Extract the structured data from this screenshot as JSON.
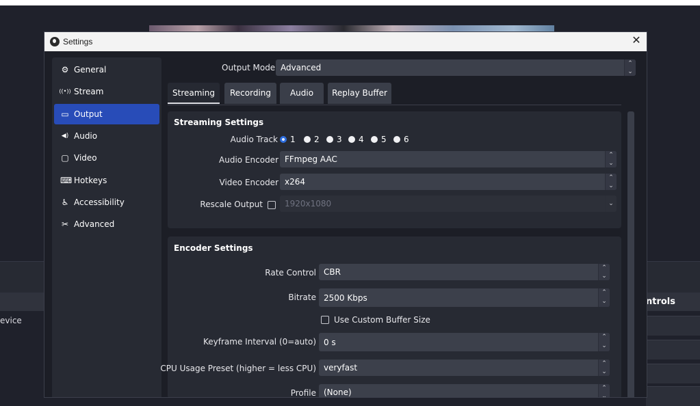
{
  "background": {
    "left_panel_item": "evice",
    "right_panel_header": "ntrols"
  },
  "dialog": {
    "title": "Settings",
    "close_glyph": "✕"
  },
  "sidebar": {
    "items": [
      {
        "label": "General",
        "icon": "gear-icon",
        "glyph": "⚙",
        "active": false
      },
      {
        "label": "Stream",
        "icon": "antenna-icon",
        "glyph": "((•))",
        "active": false
      },
      {
        "label": "Output",
        "icon": "monitor-output-icon",
        "glyph": "▭",
        "active": true
      },
      {
        "label": "Audio",
        "icon": "speaker-icon",
        "glyph": "◀)",
        "active": false
      },
      {
        "label": "Video",
        "icon": "screen-icon",
        "glyph": "▢",
        "active": false
      },
      {
        "label": "Hotkeys",
        "icon": "keyboard-icon",
        "glyph": "⌨",
        "active": false
      },
      {
        "label": "Accessibility",
        "icon": "accessibility-icon",
        "glyph": "♿",
        "active": false
      },
      {
        "label": "Advanced",
        "icon": "tools-icon",
        "glyph": "✂",
        "active": false
      }
    ]
  },
  "output_mode": {
    "label": "Output Mode",
    "value": "Advanced"
  },
  "tabs": [
    {
      "label": "Streaming",
      "active": true
    },
    {
      "label": "Recording",
      "active": false
    },
    {
      "label": "Audio",
      "active": false
    },
    {
      "label": "Replay Buffer",
      "active": false
    }
  ],
  "streaming_settings": {
    "title": "Streaming Settings",
    "audio_track_label": "Audio Track",
    "audio_tracks": [
      "1",
      "2",
      "3",
      "4",
      "5",
      "6"
    ],
    "audio_track_selected": "1",
    "audio_encoder_label": "Audio Encoder",
    "audio_encoder_value": "FFmpeg AAC",
    "video_encoder_label": "Video Encoder",
    "video_encoder_value": "x264",
    "rescale_label": "Rescale Output",
    "rescale_checked": false,
    "rescale_value": "1920x1080"
  },
  "encoder_settings": {
    "title": "Encoder Settings",
    "rate_control_label": "Rate Control",
    "rate_control_value": "CBR",
    "bitrate_label": "Bitrate",
    "bitrate_value": "2500 Kbps",
    "custom_buffer_label": "Use Custom Buffer Size",
    "custom_buffer_checked": false,
    "keyframe_label": "Keyframe Interval (0=auto)",
    "keyframe_value": "0 s",
    "cpu_preset_label": "CPU Usage Preset (higher = less CPU)",
    "cpu_preset_value": "veryfast",
    "profile_label": "Profile",
    "profile_value": "(None)"
  },
  "colors": {
    "accent": "#284cb8",
    "radio_checked": "#2f6fe0",
    "dialog_bg": "#1c1e26",
    "panel_bg": "#272a33",
    "field_bg": "#3c404b"
  }
}
